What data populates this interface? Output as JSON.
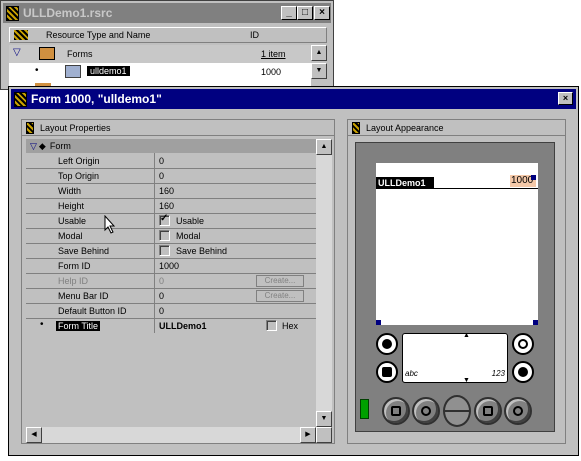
{
  "rsrc_window": {
    "title": "ULLDemo1.rsrc",
    "buttons": {
      "minimize": "_",
      "maximize": "□",
      "close": "×"
    },
    "columns": {
      "name": "Resource Type and Name",
      "id": "ID"
    },
    "rows": [
      {
        "name": "Forms",
        "id": "1 item"
      },
      {
        "name": "ulldemo1",
        "id": "1000"
      }
    ]
  },
  "form_window": {
    "title": "Form 1000, \"ulldemo1\"",
    "close": "×",
    "props_panel": {
      "title": "Layout Properties",
      "group": "Form",
      "rows": [
        {
          "label": "Left Origin",
          "value": "0"
        },
        {
          "label": "Top Origin",
          "value": "0"
        },
        {
          "label": "Width",
          "value": "160"
        },
        {
          "label": "Height",
          "value": "160"
        },
        {
          "label": "Usable",
          "value": "Usable",
          "checked": true
        },
        {
          "label": "Modal",
          "value": "Modal",
          "checked": false
        },
        {
          "label": "Save Behind",
          "value": "Save Behind",
          "checked": false
        },
        {
          "label": "Form ID",
          "value": "1000"
        },
        {
          "label": "Help ID",
          "value": "0",
          "button": "Create..."
        },
        {
          "label": "Menu Bar ID",
          "value": "0",
          "button": "Create..."
        },
        {
          "label": "Default Button ID",
          "value": "0"
        },
        {
          "label": "Form Title",
          "value": "ULLDemo1",
          "extra": "Hex"
        }
      ]
    },
    "appear_panel": {
      "title": "Layout Appearance",
      "form_title": "ULLDemo1",
      "form_id": "1000"
    }
  }
}
